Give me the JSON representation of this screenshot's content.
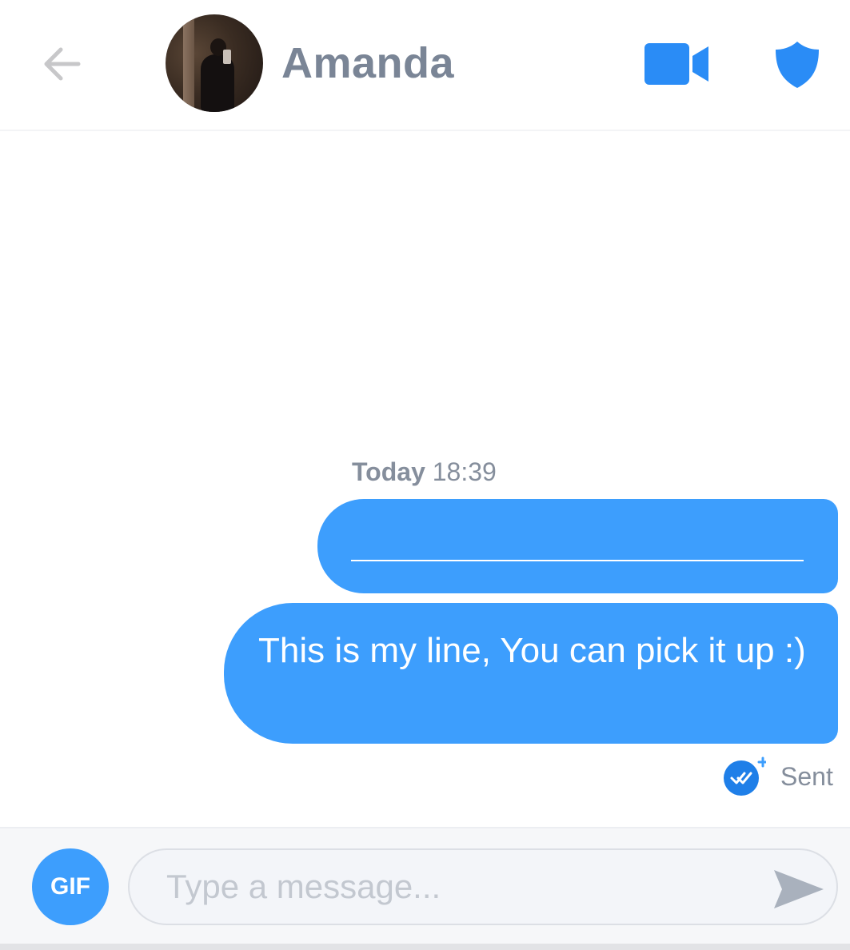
{
  "header": {
    "back_icon": "arrow-left-icon",
    "contact_name": "Amanda",
    "video_icon": "video-camera-icon",
    "safety_icon": "shield-icon"
  },
  "conversation": {
    "timestamp_day": "Today",
    "timestamp_time": "18:39",
    "messages": [
      {
        "from": "me",
        "text": "",
        "content": "blank-line"
      },
      {
        "from": "me",
        "text": "This is my line, You can pick it up :)"
      }
    ],
    "status_icon": "double-check-icon",
    "status_text": "Sent"
  },
  "composer": {
    "gif_label": "GIF",
    "placeholder": "Type a message...",
    "value": "",
    "send_icon": "send-icon"
  },
  "colors": {
    "accent": "#3d9efd",
    "name_text": "#7a8596",
    "meta_text": "#858e9c"
  }
}
